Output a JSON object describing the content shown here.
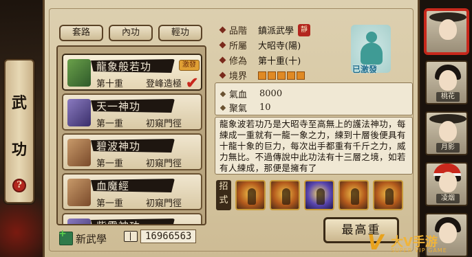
{
  "sidebar": {
    "title_char_1": "武",
    "title_char_2": "功",
    "help_label": "?"
  },
  "tabs": [
    {
      "label": "套路"
    },
    {
      "label": "內功"
    },
    {
      "label": "輕功"
    }
  ],
  "skills": [
    {
      "name": "龍象般若功",
      "level": "第十重",
      "stage": "登峰造極",
      "badge": "激發",
      "checked": true
    },
    {
      "name": "天一神功",
      "level": "第一重",
      "stage": "初窺門徑"
    },
    {
      "name": "碧波神功",
      "level": "第一重",
      "stage": "初窺門徑"
    },
    {
      "name": "血魔經",
      "level": "第一重",
      "stage": "初窺門徑"
    },
    {
      "name": "紫霞神功",
      "level": "",
      "stage": ""
    }
  ],
  "footer": {
    "new_skill_label": "新武學",
    "exp_value": "16966563"
  },
  "info": {
    "grade_label": "品階",
    "grade_value": "鎮派武學",
    "sect_badge": "靜",
    "belong_label": "所屬",
    "belong_value": "大昭寺(陽)",
    "practice_label": "修為",
    "practice_value": "第十重(十)",
    "realm_label": "境界",
    "realm_level": 5
  },
  "avatar": {
    "status": "已激發"
  },
  "stats": [
    {
      "label": "氣血",
      "value": "8000"
    },
    {
      "label": "聚氣",
      "value": "10"
    }
  ],
  "description": "龍象波若功乃是大昭寺至高無上的護法神功，每練成一重就有一龍一象之力，練到十層後便具有十龍十象的巨力，每次出手都重有千斤之力，威力無比。不過傳說中此功法有十三層之境，如若有人練成，那便是擁有了",
  "moves": {
    "label_1": "招",
    "label_2": "式",
    "count": 5
  },
  "max_button": "最高重",
  "characters": [
    {
      "name": ""
    },
    {
      "name": "桃花"
    },
    {
      "name": "月影"
    },
    {
      "name": "凌烟"
    },
    {
      "name": ""
    }
  ],
  "watermark": {
    "brand_cn": "大V手游",
    "brand_en": "SUPER VIP GAME",
    "mark": "V"
  }
}
